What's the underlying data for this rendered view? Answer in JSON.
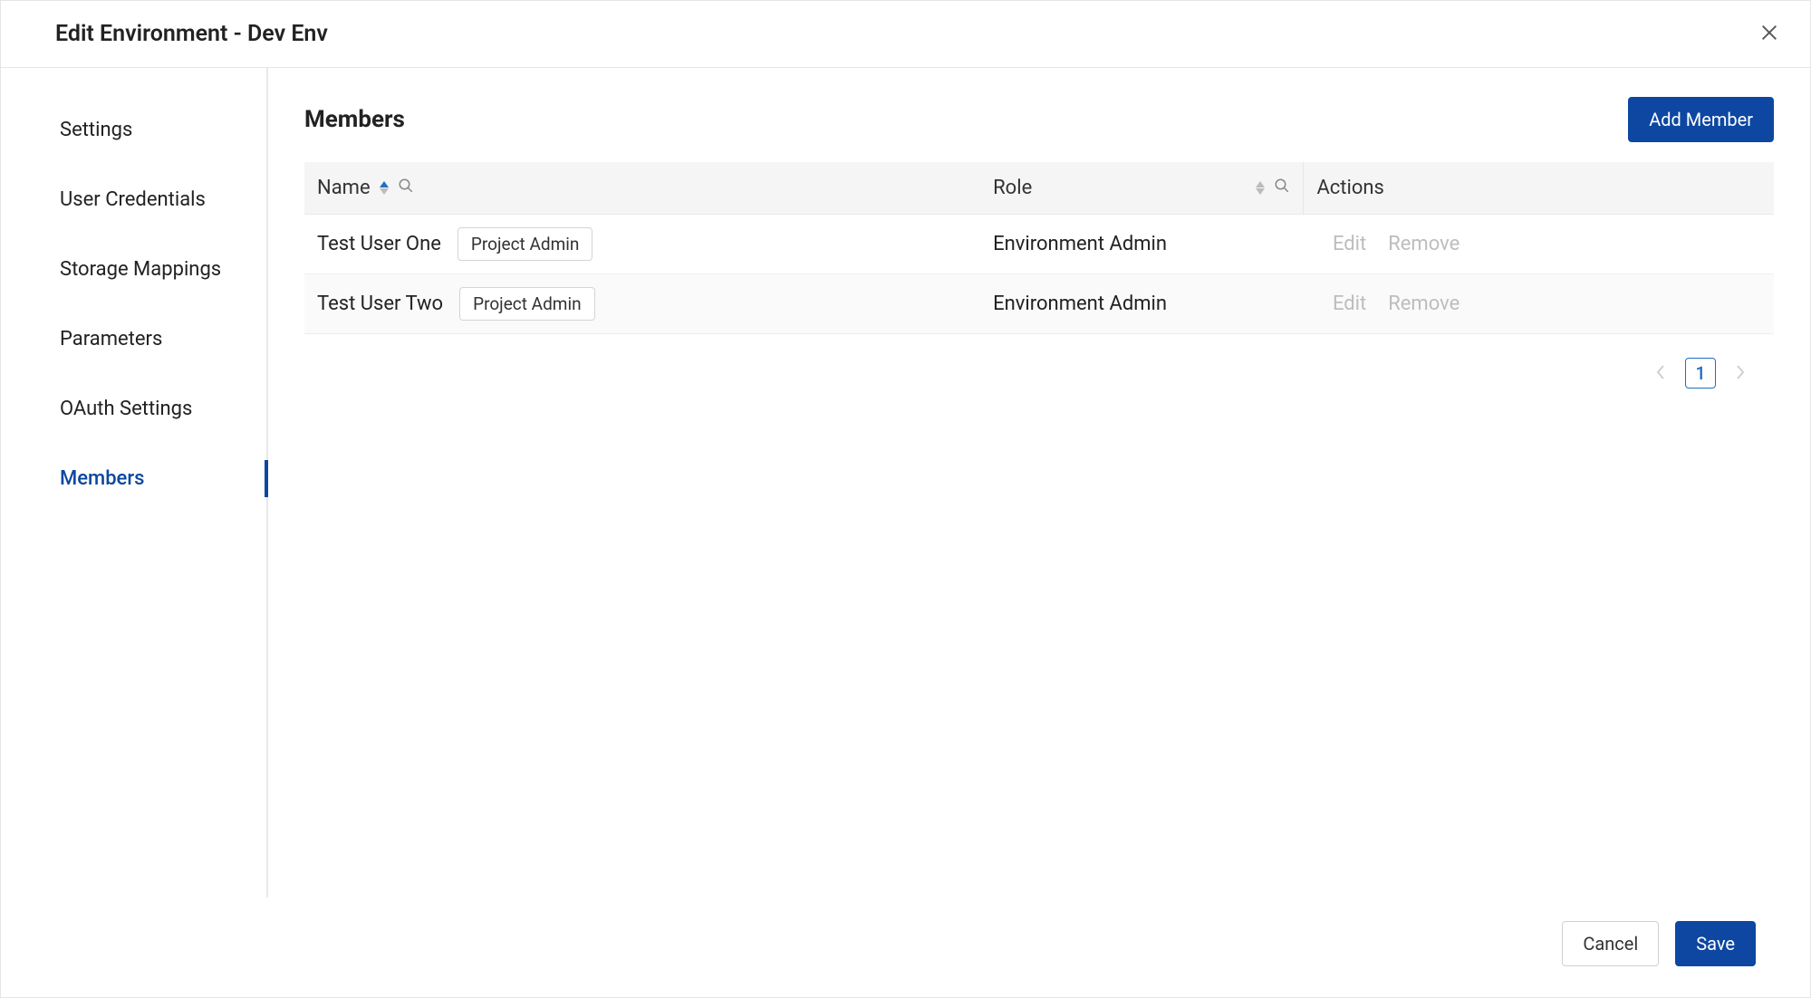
{
  "header": {
    "title": "Edit Environment - Dev Env"
  },
  "sidebar": {
    "items": [
      {
        "label": "Settings",
        "active": false
      },
      {
        "label": "User Credentials",
        "active": false
      },
      {
        "label": "Storage Mappings",
        "active": false
      },
      {
        "label": "Parameters",
        "active": false
      },
      {
        "label": "OAuth Settings",
        "active": false
      },
      {
        "label": "Members",
        "active": true
      }
    ]
  },
  "main": {
    "section_title": "Members",
    "add_button": "Add Member",
    "columns": {
      "name": "Name",
      "role": "Role",
      "actions": "Actions"
    },
    "rows": [
      {
        "name": "Test User One",
        "chip": "Project Admin",
        "role": "Environment Admin",
        "edit": "Edit",
        "remove": "Remove"
      },
      {
        "name": "Test User Two",
        "chip": "Project Admin",
        "role": "Environment Admin",
        "edit": "Edit",
        "remove": "Remove"
      }
    ],
    "pagination": {
      "current": "1"
    }
  },
  "footer": {
    "cancel": "Cancel",
    "save": "Save"
  }
}
